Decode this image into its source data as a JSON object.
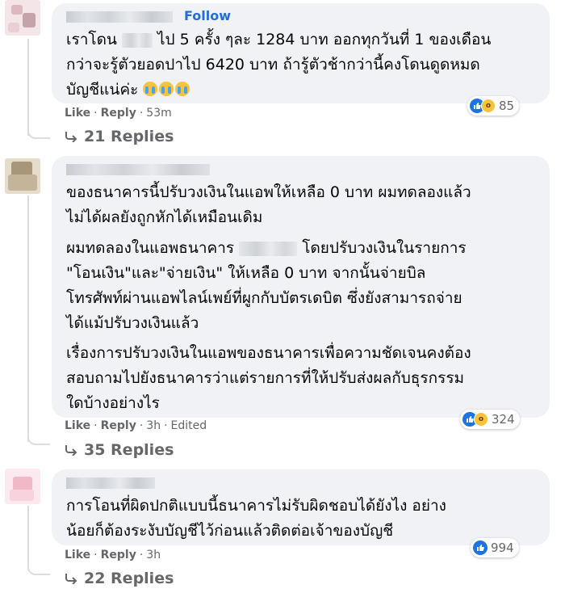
{
  "comments": [
    {
      "follow_label": "Follow",
      "paragraphs": [
        [
          {
            "pre": "เราโดน",
            "post": "ไป 5 ครั้ง ๆละ 1284 บาท ออกทุกวันที่ 1 ของเดือน"
          },
          {
            "pre": "กว่าจะรู้ตัวยอดปาไป 6420 บาท ถ้ารู้ตัวช้ากว่านี้คงโดนดูดหมด"
          },
          {
            "pre": "บัญชีแน่ค่ะ"
          }
        ]
      ],
      "reaction_count": "85",
      "actions": {
        "like": "Like",
        "reply": "Reply",
        "time": "53m"
      },
      "replies_label": "21 Replies"
    },
    {
      "paragraphs": [
        [
          {
            "pre": "ของธนาคารนี้ปรับวงเงินในแอพให้เหลือ 0 บาท ผมทดลองแล้ว"
          },
          {
            "pre": "ไม่ได้ผลยังถูกหักได้เหมือนเดิม"
          }
        ],
        [
          {
            "pre": "ผมทดลองในแอพธนาคาร",
            "post": "โดยปรับวงเงินในรายการ"
          },
          {
            "pre": "\"โอนเงิน\"และ\"จ่ายเงิน\" ให้เหลือ 0 บาท จากนั้นจ่ายบิล"
          },
          {
            "pre": "โทรศัพท์ผ่านแอพไลน์เพย์ที่ผูกกับบัตรเดบิต ซึ่งยังสามารถจ่าย"
          },
          {
            "pre": "ได้แม้ปรับวงเงินแล้ว"
          }
        ],
        [
          {
            "pre": "เรื่องการปรับวงเงินในแอพของธนาคารเพื่อความชัดเจนคงต้อง"
          },
          {
            "pre": "สอบถามไปยังธนาคารว่าแต่รายการที่ให้ปรับส่งผลกับธุรกรรม"
          },
          {
            "pre": "ใดบ้างอย่างไร"
          }
        ]
      ],
      "reaction_count": "324",
      "actions": {
        "like": "Like",
        "reply": "Reply",
        "time": "3h",
        "edited": "Edited"
      },
      "replies_label": "35 Replies"
    },
    {
      "paragraphs": [
        [
          {
            "pre": "การโอนที่ผิดปกติแบบนี้ธนาคารไม่รับผิดชอบได้ยังไง อย่าง"
          },
          {
            "pre": "น้อยก็ต้องระงับบัญชีไว้ก่อนแล้วติดต่อเจ้าของบัญชี"
          }
        ]
      ],
      "reaction_count": "994",
      "actions": {
        "like": "Like",
        "reply": "Reply",
        "time": "3h"
      },
      "replies_label": "22 Replies"
    }
  ],
  "icons": {
    "like": "like-reaction-icon",
    "wow": "wow-reaction-icon",
    "cry": "crying-face-emoji",
    "reply_arrow": "reply-arrow-icon"
  },
  "colors": {
    "link_blue": "#216fdb",
    "like_blue": "#1b74e4",
    "bubble_bg": "#f0f2f5",
    "meta_gray": "#65676b"
  }
}
